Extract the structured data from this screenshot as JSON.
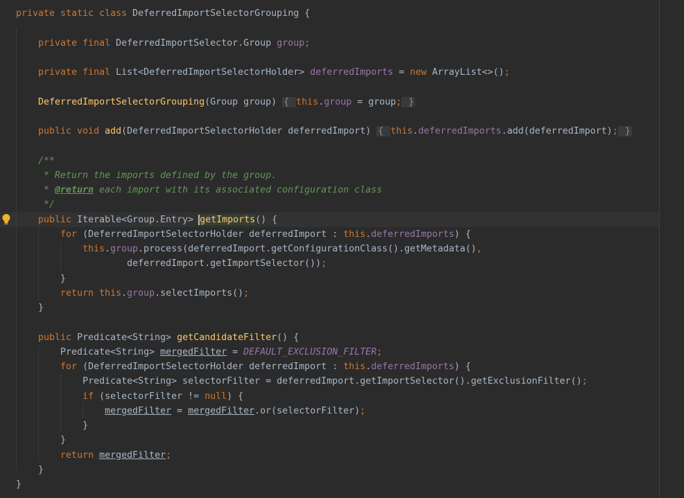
{
  "editor": {
    "colors": {
      "background": "#2b2b2b",
      "keyword": "#cc7832",
      "field": "#9876aa",
      "method": "#ffc66d",
      "comment": "#629755",
      "text": "#a9b7c6"
    },
    "intention_icon": "lightbulb-icon",
    "lines": [
      {
        "tokens": [
          {
            "t": "private",
            "c": "kw"
          },
          {
            "t": " "
          },
          {
            "t": "static",
            "c": "kw"
          },
          {
            "t": " "
          },
          {
            "t": "class",
            "c": "kw"
          },
          {
            "t": " DeferredImportSelectorGrouping {"
          }
        ]
      },
      {
        "tokens": []
      },
      {
        "tokens": [
          {
            "t": "    "
          },
          {
            "t": "private",
            "c": "kw"
          },
          {
            "t": " "
          },
          {
            "t": "final",
            "c": "kw"
          },
          {
            "t": " DeferredImportSelector.Group "
          },
          {
            "t": "group",
            "c": "fld"
          },
          {
            "t": ";",
            "c": "kw"
          }
        ]
      },
      {
        "tokens": []
      },
      {
        "tokens": [
          {
            "t": "    "
          },
          {
            "t": "private",
            "c": "kw"
          },
          {
            "t": " "
          },
          {
            "t": "final",
            "c": "kw"
          },
          {
            "t": " List<DeferredImportSelectorHolder> "
          },
          {
            "t": "deferredImports",
            "c": "fld"
          },
          {
            "t": " = "
          },
          {
            "t": "new",
            "c": "kw"
          },
          {
            "t": " ArrayList<>()"
          },
          {
            "t": ";",
            "c": "kw"
          }
        ]
      },
      {
        "tokens": []
      },
      {
        "tokens": [
          {
            "t": "    "
          },
          {
            "t": "DeferredImportSelectorGrouping",
            "c": "fn"
          },
          {
            "t": "(Group group) "
          },
          {
            "t": "{ ",
            "c": "fold"
          },
          {
            "t": "this",
            "c": "kw"
          },
          {
            "t": "."
          },
          {
            "t": "group",
            "c": "fld"
          },
          {
            "t": " = group"
          },
          {
            "t": ";",
            "c": "kw"
          },
          {
            "t": " }",
            "c": "fold"
          }
        ]
      },
      {
        "tokens": []
      },
      {
        "tokens": [
          {
            "t": "    "
          },
          {
            "t": "public",
            "c": "kw"
          },
          {
            "t": " "
          },
          {
            "t": "void",
            "c": "kw"
          },
          {
            "t": " "
          },
          {
            "t": "add",
            "c": "fn"
          },
          {
            "t": "(DeferredImportSelectorHolder deferredImport) "
          },
          {
            "t": "{ ",
            "c": "fold"
          },
          {
            "t": "this",
            "c": "kw"
          },
          {
            "t": "."
          },
          {
            "t": "deferredImports",
            "c": "fld"
          },
          {
            "t": ".add(deferredImport)"
          },
          {
            "t": ";",
            "c": "kw"
          },
          {
            "t": " }",
            "c": "fold"
          }
        ]
      },
      {
        "tokens": []
      },
      {
        "tokens": [
          {
            "t": "    /**",
            "c": "cm"
          }
        ]
      },
      {
        "tokens": [
          {
            "t": "     * Return the imports defined by the group.",
            "c": "cm"
          }
        ]
      },
      {
        "tokens": [
          {
            "t": "     * ",
            "c": "cm"
          },
          {
            "t": "@return",
            "c": "tag"
          },
          {
            "t": " each import with its associated configuration class",
            "c": "cm"
          }
        ]
      },
      {
        "tokens": [
          {
            "t": "     */",
            "c": "cm"
          }
        ]
      },
      {
        "tokens": [
          {
            "t": "    "
          },
          {
            "t": "public",
            "c": "kw"
          },
          {
            "t": " Iterable<Group.Entry> "
          },
          {
            "t": "getImports",
            "c": "fn caret hl-ident"
          },
          {
            "t": "() {"
          }
        ]
      },
      {
        "tokens": [
          {
            "t": "        "
          },
          {
            "t": "for",
            "c": "kw"
          },
          {
            "t": " (DeferredImportSelectorHolder deferredImport : "
          },
          {
            "t": "this",
            "c": "kw"
          },
          {
            "t": "."
          },
          {
            "t": "deferredImports",
            "c": "fld"
          },
          {
            "t": ") {"
          }
        ]
      },
      {
        "tokens": [
          {
            "t": "            "
          },
          {
            "t": "this",
            "c": "kw"
          },
          {
            "t": "."
          },
          {
            "t": "group",
            "c": "fld"
          },
          {
            "t": ".process(deferredImport.getConfigurationClass().getMetadata()"
          },
          {
            "t": ",",
            "c": "kw"
          }
        ]
      },
      {
        "tokens": [
          {
            "t": "                    deferredImport.getImportSelector())"
          },
          {
            "t": ";",
            "c": "kw"
          }
        ]
      },
      {
        "tokens": [
          {
            "t": "        }"
          }
        ]
      },
      {
        "tokens": [
          {
            "t": "        "
          },
          {
            "t": "return",
            "c": "kw"
          },
          {
            "t": " "
          },
          {
            "t": "this",
            "c": "kw"
          },
          {
            "t": "."
          },
          {
            "t": "group",
            "c": "fld"
          },
          {
            "t": ".selectImports()"
          },
          {
            "t": ";",
            "c": "kw"
          }
        ]
      },
      {
        "tokens": [
          {
            "t": "    }"
          }
        ]
      },
      {
        "tokens": []
      },
      {
        "tokens": [
          {
            "t": "    "
          },
          {
            "t": "public",
            "c": "kw"
          },
          {
            "t": " Predicate<String> "
          },
          {
            "t": "getCandidateFilter",
            "c": "fn"
          },
          {
            "t": "() {"
          }
        ]
      },
      {
        "tokens": [
          {
            "t": "        Predicate<String> "
          },
          {
            "t": "mergedFilter",
            "c": "ul"
          },
          {
            "t": " = "
          },
          {
            "t": "DEFAULT_EXCLUSION_FILTER",
            "c": "cst"
          },
          {
            "t": ";",
            "c": "kw"
          }
        ]
      },
      {
        "tokens": [
          {
            "t": "        "
          },
          {
            "t": "for",
            "c": "kw"
          },
          {
            "t": " (DeferredImportSelectorHolder deferredImport : "
          },
          {
            "t": "this",
            "c": "kw"
          },
          {
            "t": "."
          },
          {
            "t": "deferredImports",
            "c": "fld"
          },
          {
            "t": ") {"
          }
        ]
      },
      {
        "tokens": [
          {
            "t": "            Predicate<String> selectorFilter = deferredImport.getImportSelector().getExclusionFilter()"
          },
          {
            "t": ";",
            "c": "kw"
          }
        ]
      },
      {
        "tokens": [
          {
            "t": "            "
          },
          {
            "t": "if",
            "c": "kw"
          },
          {
            "t": " (selectorFilter != "
          },
          {
            "t": "null",
            "c": "kw"
          },
          {
            "t": ") {"
          }
        ]
      },
      {
        "tokens": [
          {
            "t": "                "
          },
          {
            "t": "mergedFilter",
            "c": "ul"
          },
          {
            "t": " = "
          },
          {
            "t": "mergedFilter",
            "c": "ul"
          },
          {
            "t": ".or(selectorFilter)"
          },
          {
            "t": ";",
            "c": "kw"
          }
        ]
      },
      {
        "tokens": [
          {
            "t": "            }"
          }
        ]
      },
      {
        "tokens": [
          {
            "t": "        }"
          }
        ]
      },
      {
        "tokens": [
          {
            "t": "        "
          },
          {
            "t": "return",
            "c": "kw"
          },
          {
            "t": " "
          },
          {
            "t": "mergedFilter",
            "c": "ul"
          },
          {
            "t": ";",
            "c": "kw"
          }
        ]
      },
      {
        "tokens": [
          {
            "t": "    }"
          }
        ]
      },
      {
        "tokens": [
          {
            "t": "}"
          }
        ]
      }
    ]
  }
}
